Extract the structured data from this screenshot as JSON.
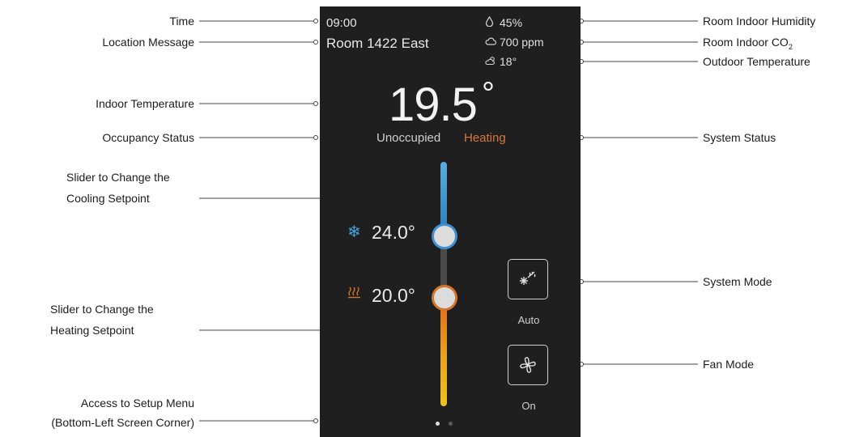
{
  "screen": {
    "time": "09:00",
    "location": "Room 1422 East",
    "humidity": "45%",
    "co2": "700 ppm",
    "outdoor_temp": "18°",
    "indoor_temp": "19.5",
    "indoor_temp_unit": "°",
    "occupancy": "Unoccupied",
    "system_status": "Heating",
    "cooling_setpoint": "24.0°",
    "heating_setpoint": "20.0°",
    "system_mode": "Auto",
    "fan_mode": "On",
    "page_dots": 2,
    "active_page": 1,
    "icons": {
      "humidity": "droplet-icon",
      "co2": "cloud-icon",
      "outdoor": "sun-cloud-icon",
      "cooling": "snowflake-icon",
      "heating": "heat-waves-icon",
      "mode": "auto-mode-icon",
      "fan": "fan-icon"
    }
  },
  "annotations": {
    "left": {
      "time": "Time",
      "location_message": "Location Message",
      "indoor_temperature": "Indoor Temperature",
      "occupancy_status": "Occupancy Status",
      "cooling_slider": [
        "Slider to Change the",
        "Cooling Setpoint"
      ],
      "heating_slider": [
        "Slider to Change the",
        "Heating Setpoint"
      ],
      "setup_menu": [
        "Access to Setup Menu",
        "(Bottom-Left Screen Corner)"
      ]
    },
    "right": {
      "humidity": "Room Indoor Humidity",
      "co2": "Room Indoor CO",
      "co2_sub": "2",
      "outdoor_temperature": "Outdoor Temperature",
      "system_status": "System Status",
      "system_mode": "System Mode",
      "fan_mode": "Fan Mode"
    }
  },
  "colors": {
    "screen_bg": "#1f1f1f",
    "heating_accent": "#d9763a",
    "cooling_accent": "#3f8fd1"
  }
}
